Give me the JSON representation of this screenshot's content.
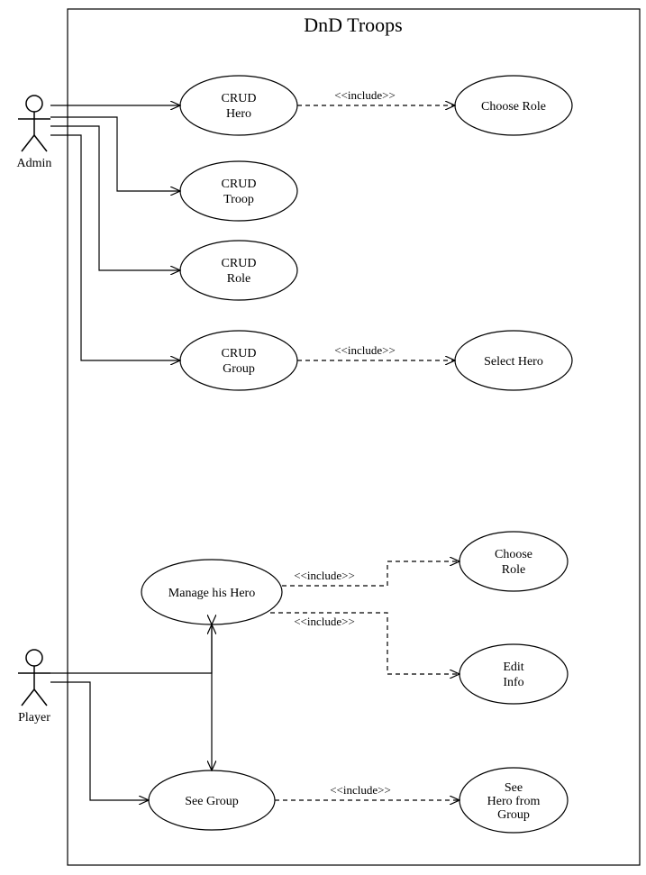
{
  "diagram": {
    "title": "DnD Troops",
    "actors": {
      "admin": "Admin",
      "player": "Player"
    },
    "usecases": {
      "crud_hero": {
        "line1": "CRUD",
        "line2": "Hero"
      },
      "crud_troop": {
        "line1": "CRUD",
        "line2": "Troop"
      },
      "crud_role": {
        "line1": "CRUD",
        "line2": "Role"
      },
      "crud_group": {
        "line1": "CRUD",
        "line2": "Group"
      },
      "choose_role_top": "Choose Role",
      "select_hero": "Select Hero",
      "manage_hero": "Manage his Hero",
      "choose_role_bottom": {
        "line1": "Choose",
        "line2": "Role"
      },
      "edit_info": {
        "line1": "Edit",
        "line2": "Info"
      },
      "see_group": "See Group",
      "see_hero_from_group": {
        "line1": "See",
        "line2": "Hero from",
        "line3": "Group"
      }
    },
    "include_label": "<<include>>"
  }
}
